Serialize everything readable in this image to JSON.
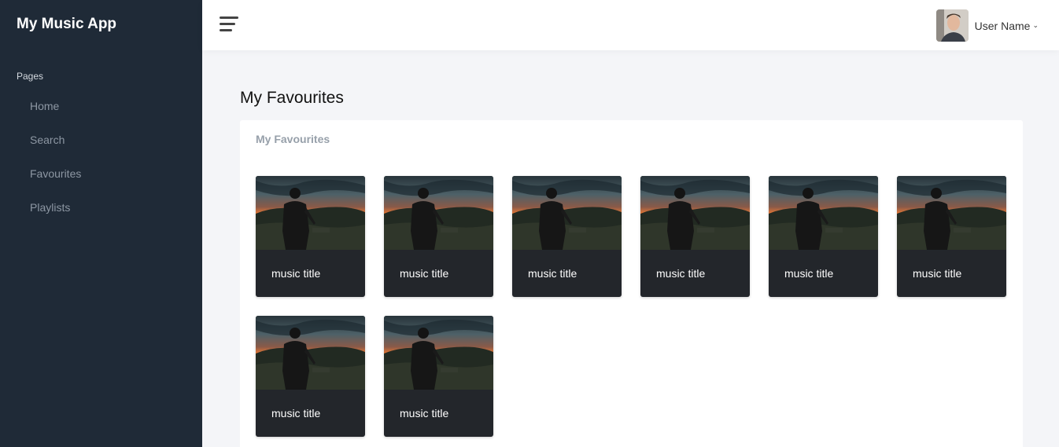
{
  "sidebar": {
    "brand": "My Music App",
    "section_label": "Pages",
    "items": [
      {
        "label": "Home"
      },
      {
        "label": "Search"
      },
      {
        "label": "Favourites"
      },
      {
        "label": "Playlists"
      }
    ]
  },
  "header": {
    "menu_icon": "hamburger-menu-icon",
    "user_name": "User Name",
    "user_caret": "⌄",
    "avatar_icon": "user-avatar"
  },
  "main": {
    "page_title": "My Favourites",
    "card_title": "My Favourites",
    "tiles": [
      {
        "title": "music title"
      },
      {
        "title": "music title"
      },
      {
        "title": "music title"
      },
      {
        "title": "music title"
      },
      {
        "title": "music title"
      },
      {
        "title": "music title"
      },
      {
        "title": "music title"
      },
      {
        "title": "music title"
      }
    ]
  },
  "colors": {
    "sidebar_bg": "#1f2a37",
    "tile_bg": "#23262b",
    "page_bg": "#f4f5f8",
    "sunset_orange": "#f07a32"
  }
}
